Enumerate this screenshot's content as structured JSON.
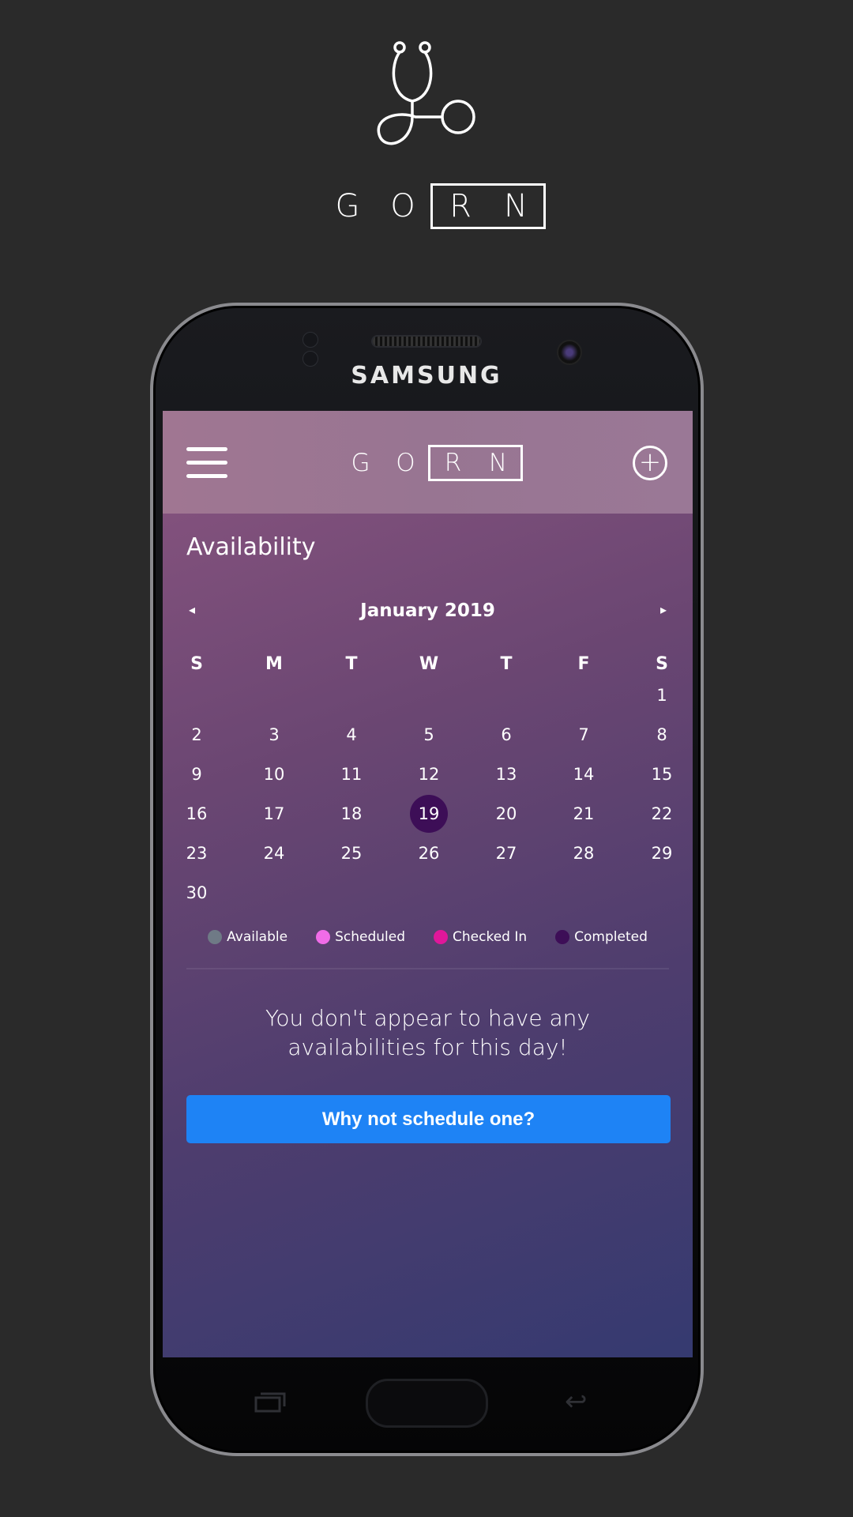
{
  "logo": {
    "icon": "stethoscope-icon",
    "wordmark_letters": [
      "G",
      "O",
      "R",
      "N"
    ]
  },
  "device": {
    "brand": "SAMSUNG"
  },
  "app_header": {
    "menu_icon": "hamburger-icon",
    "logo_letters": [
      "G",
      "O",
      "R",
      "N"
    ],
    "add_icon": "plus-circle-icon",
    "add_symbol": "+"
  },
  "page": {
    "title": "Availability"
  },
  "calendar": {
    "month_label": "January 2019",
    "prev_symbol": "◂",
    "next_symbol": "▸",
    "weekdays": [
      "S",
      "M",
      "T",
      "W",
      "T",
      "F",
      "S"
    ],
    "first_weekday_index": 6,
    "days_in_month": 31,
    "visible_days": [
      "1",
      "2",
      "3",
      "4",
      "5",
      "6",
      "7",
      "8",
      "9",
      "10",
      "11",
      "12",
      "13",
      "14",
      "15",
      "16",
      "17",
      "18",
      "19",
      "20",
      "21",
      "22",
      "23",
      "24",
      "25",
      "26",
      "27",
      "28",
      "29",
      "30"
    ],
    "selected_day": "19",
    "selected_color": "#3d0e57"
  },
  "legend": [
    {
      "label": "Available",
      "color": "#6f7a86"
    },
    {
      "label": "Scheduled",
      "color": "#f06ce8"
    },
    {
      "label": "Checked In",
      "color": "#e0179a"
    },
    {
      "label": "Completed",
      "color": "#3d0e57"
    }
  ],
  "empty_state": {
    "line1": "You don't appear to have any",
    "line2": "availabilities for this day!"
  },
  "cta": {
    "label": "Why not schedule one?",
    "color": "#1e83f5"
  },
  "nav_keys": {
    "recent_icon": "recent-apps-icon",
    "back_icon": "back-icon",
    "back_symbol": "↩"
  }
}
